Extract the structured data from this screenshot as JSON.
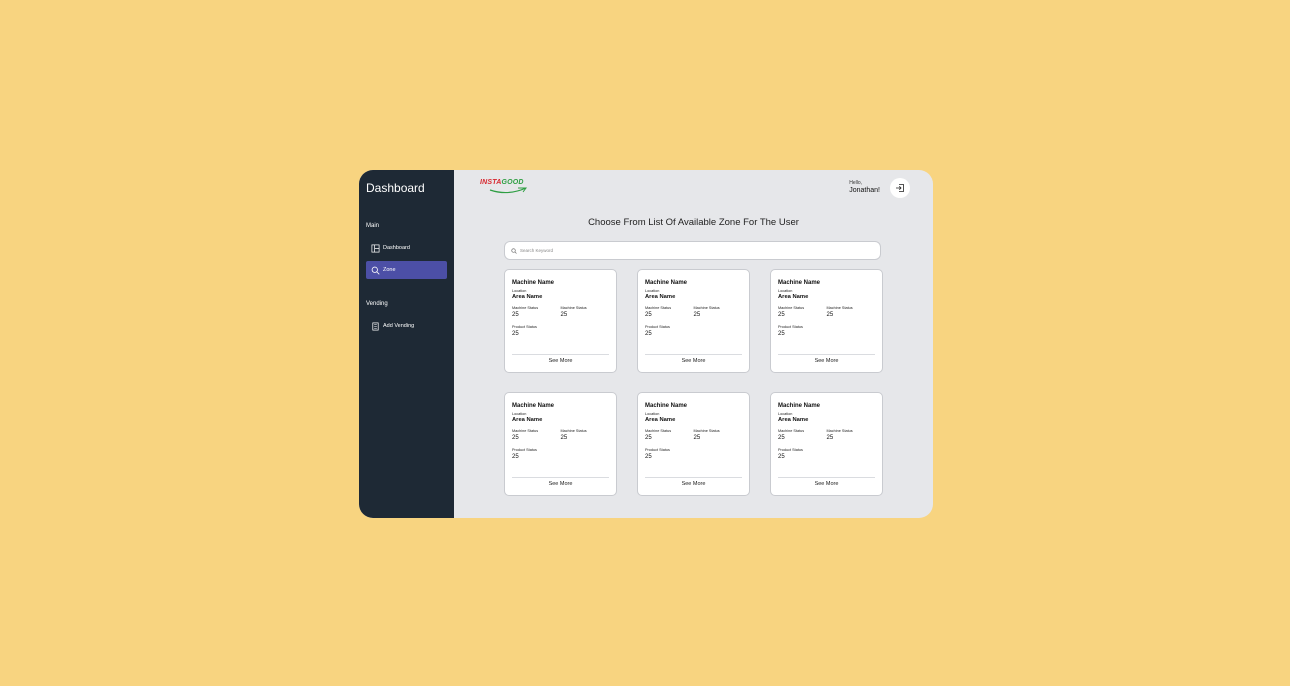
{
  "sidebar": {
    "title": "Dashboard",
    "sections": [
      {
        "label": "Main",
        "items": [
          {
            "label": "Dashboard",
            "icon": "dashboard-icon",
            "active": false
          },
          {
            "label": "Zone",
            "icon": "search-icon",
            "active": true
          }
        ]
      },
      {
        "label": "Vending",
        "items": [
          {
            "label": "Add Vending",
            "icon": "document-icon",
            "active": false
          }
        ]
      }
    ]
  },
  "header": {
    "logo_part1": "INSTA",
    "logo_part2": "GOOD",
    "greeting": "Hello,",
    "user_name": "Jonathan!",
    "logout_icon": "logout-icon"
  },
  "main": {
    "title": "Choose From List Of Available Zone For The User",
    "search_placeholder": "Search Keyword",
    "card_labels": {
      "machine_name": "Machine Name",
      "location": "Location",
      "area_name": "Area Name",
      "machine_status": "Machine Status",
      "product_status": "Product Status",
      "see_more": "See More"
    },
    "cards": [
      {
        "machine_status_1": "25",
        "machine_status_2": "25",
        "product_status": "25"
      },
      {
        "machine_status_1": "25",
        "machine_status_2": "25",
        "product_status": "25"
      },
      {
        "machine_status_1": "25",
        "machine_status_2": "25",
        "product_status": "25"
      },
      {
        "machine_status_1": "25",
        "machine_status_2": "25",
        "product_status": "25"
      },
      {
        "machine_status_1": "25",
        "machine_status_2": "25",
        "product_status": "25"
      },
      {
        "machine_status_1": "25",
        "machine_status_2": "25",
        "product_status": "25"
      }
    ]
  },
  "colors": {
    "page_bg": "#F8D480",
    "sidebar_bg": "#1E2935",
    "active_item": "#4C4FA6",
    "content_bg": "#E6E7EA",
    "logo_red": "#D7282F",
    "logo_green": "#2E9E43"
  }
}
